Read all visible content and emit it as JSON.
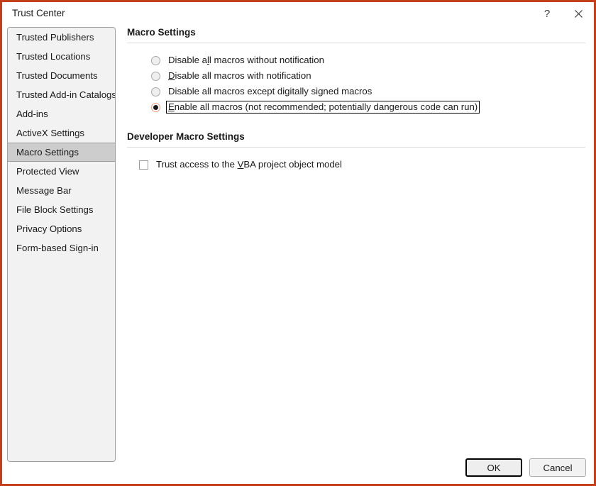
{
  "window": {
    "title": "Trust Center",
    "border_color": "#C43E1C",
    "titlebar_buttons": [
      {
        "name": "help-button",
        "glyph": "?",
        "label": "Help"
      },
      {
        "name": "close-button",
        "glyph": "✕",
        "label": "Close"
      }
    ]
  },
  "sidebar": {
    "items": [
      {
        "label": "Trusted Publishers",
        "selected": false
      },
      {
        "label": "Trusted Locations",
        "selected": false
      },
      {
        "label": "Trusted Documents",
        "selected": false
      },
      {
        "label": "Trusted Add-in Catalogs",
        "selected": false
      },
      {
        "label": "Add-ins",
        "selected": false
      },
      {
        "label": "ActiveX Settings",
        "selected": false
      },
      {
        "label": "Macro Settings",
        "selected": true
      },
      {
        "label": "Protected View",
        "selected": false
      },
      {
        "label": "Message Bar",
        "selected": false
      },
      {
        "label": "File Block Settings",
        "selected": false
      },
      {
        "label": "Privacy Options",
        "selected": false
      },
      {
        "label": "Form-based Sign-in",
        "selected": false
      }
    ]
  },
  "macro_settings": {
    "heading": "Macro Settings",
    "options": [
      {
        "label": "Disable all macros without notification",
        "accel_before": "Disable a",
        "accel": "l",
        "accel_after": "l macros without notification",
        "checked": false,
        "focused": false
      },
      {
        "label": "Disable all macros with notification",
        "accel_before": "",
        "accel": "D",
        "accel_after": "isable all macros with notification",
        "checked": false,
        "focused": false
      },
      {
        "label": "Disable all macros except digitally signed macros",
        "accel_before": "Disable all macros except digitally signed macros",
        "accel": "",
        "accel_after": "",
        "checked": false,
        "focused": false
      },
      {
        "label": "Enable all macros (not recommended; potentially dangerous code can run)",
        "accel_before": "",
        "accel": "E",
        "accel_after": "nable all macros (not recommended; potentially dangerous code can run)",
        "checked": true,
        "focused": true
      }
    ]
  },
  "developer_macro_settings": {
    "heading": "Developer Macro Settings",
    "checkbox": {
      "label": "Trust access to the VBA project object model",
      "accel_before": "Trust access to the ",
      "accel": "V",
      "accel_after": "BA project object model",
      "checked": false
    }
  },
  "footer": {
    "ok_label": "OK",
    "cancel_label": "Cancel"
  }
}
